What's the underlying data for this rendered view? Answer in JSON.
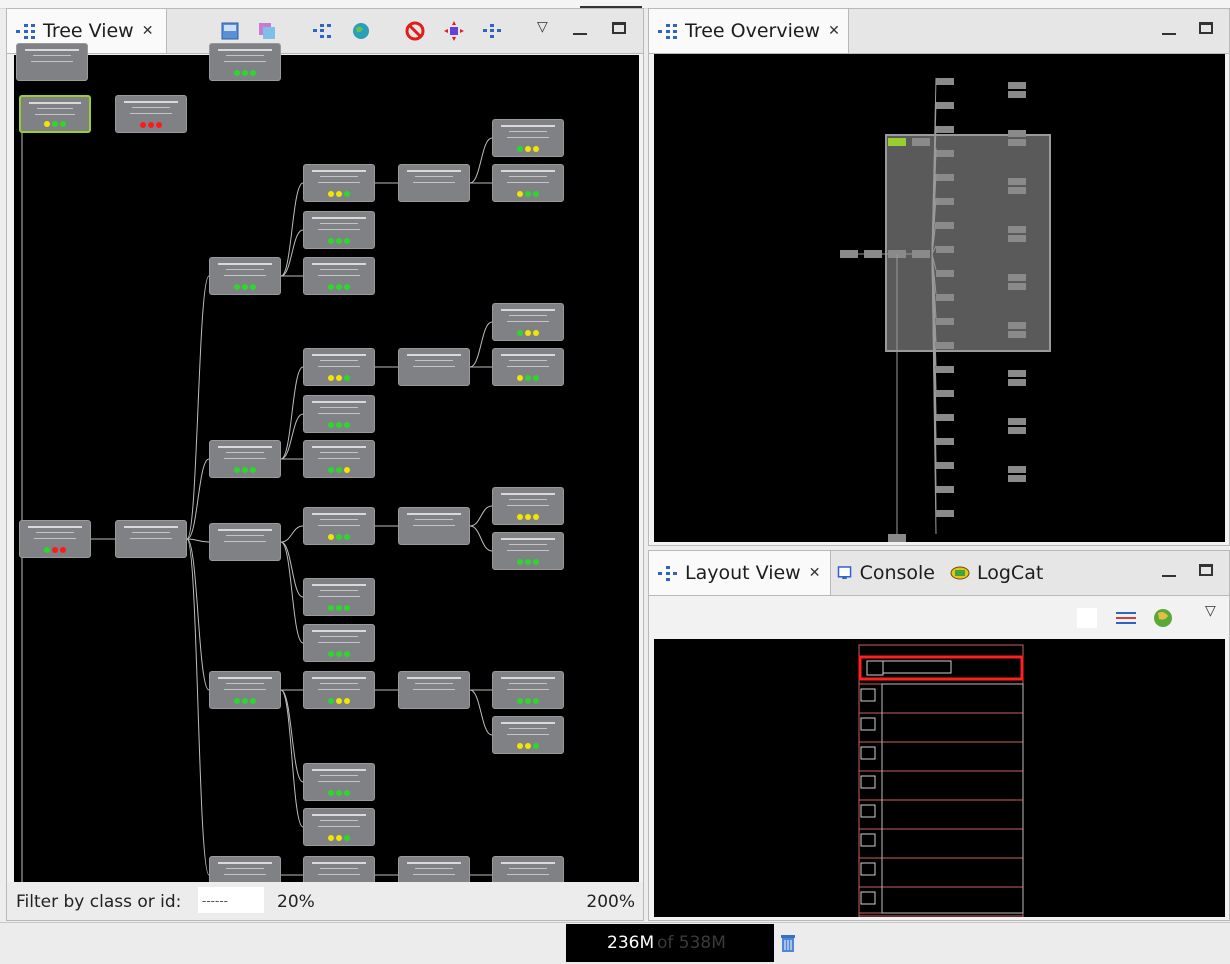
{
  "tree_view": {
    "tab_title": "Tree View",
    "filter_label": "Filter by class or id:",
    "filter_value": "------",
    "zoom_min": "20%",
    "zoom_max": "200%",
    "nodes": [
      {
        "name": "node-top-gray-1",
        "dots": []
      },
      {
        "name": "node-relative-left",
        "dots": [
          "y",
          "g",
          "g"
        ]
      },
      {
        "name": "node-relative-right",
        "dots": [
          "r",
          "r",
          "r"
        ]
      },
      {
        "name": "node-top-partial",
        "dots": [
          "g",
          "g",
          "g"
        ]
      },
      {
        "name": "node-frame",
        "dots": [
          "g",
          "r",
          "r"
        ]
      },
      {
        "name": "node-root-child",
        "dots": []
      },
      {
        "name": "node-ll-1",
        "dots": [
          "g",
          "g",
          "g"
        ]
      },
      {
        "name": "node-ll-1a",
        "dots": [
          "y",
          "y",
          "g"
        ]
      },
      {
        "name": "node-img-1",
        "dots": [
          "g",
          "g",
          "g"
        ]
      },
      {
        "name": "node-txt-1",
        "dots": [
          "g",
          "g",
          "g"
        ]
      },
      {
        "name": "node-ll-1b",
        "dots": []
      },
      {
        "name": "node-txt-1a",
        "dots": [
          "g",
          "y",
          "y"
        ]
      },
      {
        "name": "node-txt-1b",
        "dots": [
          "y",
          "g",
          "g"
        ]
      },
      {
        "name": "node-ll-2",
        "dots": [
          "g",
          "g",
          "g"
        ]
      },
      {
        "name": "node-ll-2a",
        "dots": [
          "y",
          "y",
          "g"
        ]
      },
      {
        "name": "node-img-2",
        "dots": [
          "g",
          "g",
          "g"
        ]
      },
      {
        "name": "node-txt-2",
        "dots": [
          "g",
          "g",
          "y"
        ]
      },
      {
        "name": "node-ll-2b",
        "dots": []
      },
      {
        "name": "node-txt-2a",
        "dots": [
          "g",
          "y",
          "y"
        ]
      },
      {
        "name": "node-txt-2b",
        "dots": [
          "y",
          "g",
          "g"
        ]
      },
      {
        "name": "node-ll-3",
        "dots": []
      },
      {
        "name": "node-ll-3a",
        "dots": [
          "y",
          "g",
          "g"
        ]
      },
      {
        "name": "node-img-3",
        "dots": [
          "g",
          "g",
          "g"
        ]
      },
      {
        "name": "node-txt-3",
        "dots": [
          "g",
          "g",
          "g"
        ]
      },
      {
        "name": "node-ll-3b",
        "dots": []
      },
      {
        "name": "node-txt-3a",
        "dots": [
          "y",
          "y",
          "y"
        ]
      },
      {
        "name": "node-txt-3b",
        "dots": [
          "g",
          "g",
          "g"
        ]
      },
      {
        "name": "node-ll-4",
        "dots": [
          "g",
          "g",
          "g"
        ]
      },
      {
        "name": "node-ll-4a",
        "dots": [
          "g",
          "y",
          "y"
        ]
      },
      {
        "name": "node-img-4",
        "dots": [
          "g",
          "g",
          "g"
        ]
      },
      {
        "name": "node-txt-4",
        "dots": [
          "y",
          "y",
          "g"
        ]
      },
      {
        "name": "node-ll-4b",
        "dots": []
      },
      {
        "name": "node-txt-4a",
        "dots": [
          "g",
          "g",
          "g"
        ]
      },
      {
        "name": "node-txt-4b",
        "dots": [
          "y",
          "y",
          "g"
        ]
      },
      {
        "name": "node-ll-5",
        "dots": []
      },
      {
        "name": "node-ll-5a",
        "dots": []
      },
      {
        "name": "node-ll-5b",
        "dots": []
      },
      {
        "name": "node-txt-5a",
        "dots": []
      }
    ]
  },
  "tree_overview": {
    "tab_title": "Tree Overview"
  },
  "layout_view": {
    "tabs": [
      {
        "label": "Layout View"
      },
      {
        "label": "Console"
      },
      {
        "label": "LogCat"
      }
    ],
    "colors": {
      "selection": "#ff2020",
      "outline": "#c86060"
    }
  },
  "status": {
    "memory_used": "236M",
    "memory_rest": "of 538M"
  },
  "colors": {
    "accent_blue": "#2e63c7",
    "tree_bg": "#000000",
    "node_gray": "#7f8185"
  }
}
